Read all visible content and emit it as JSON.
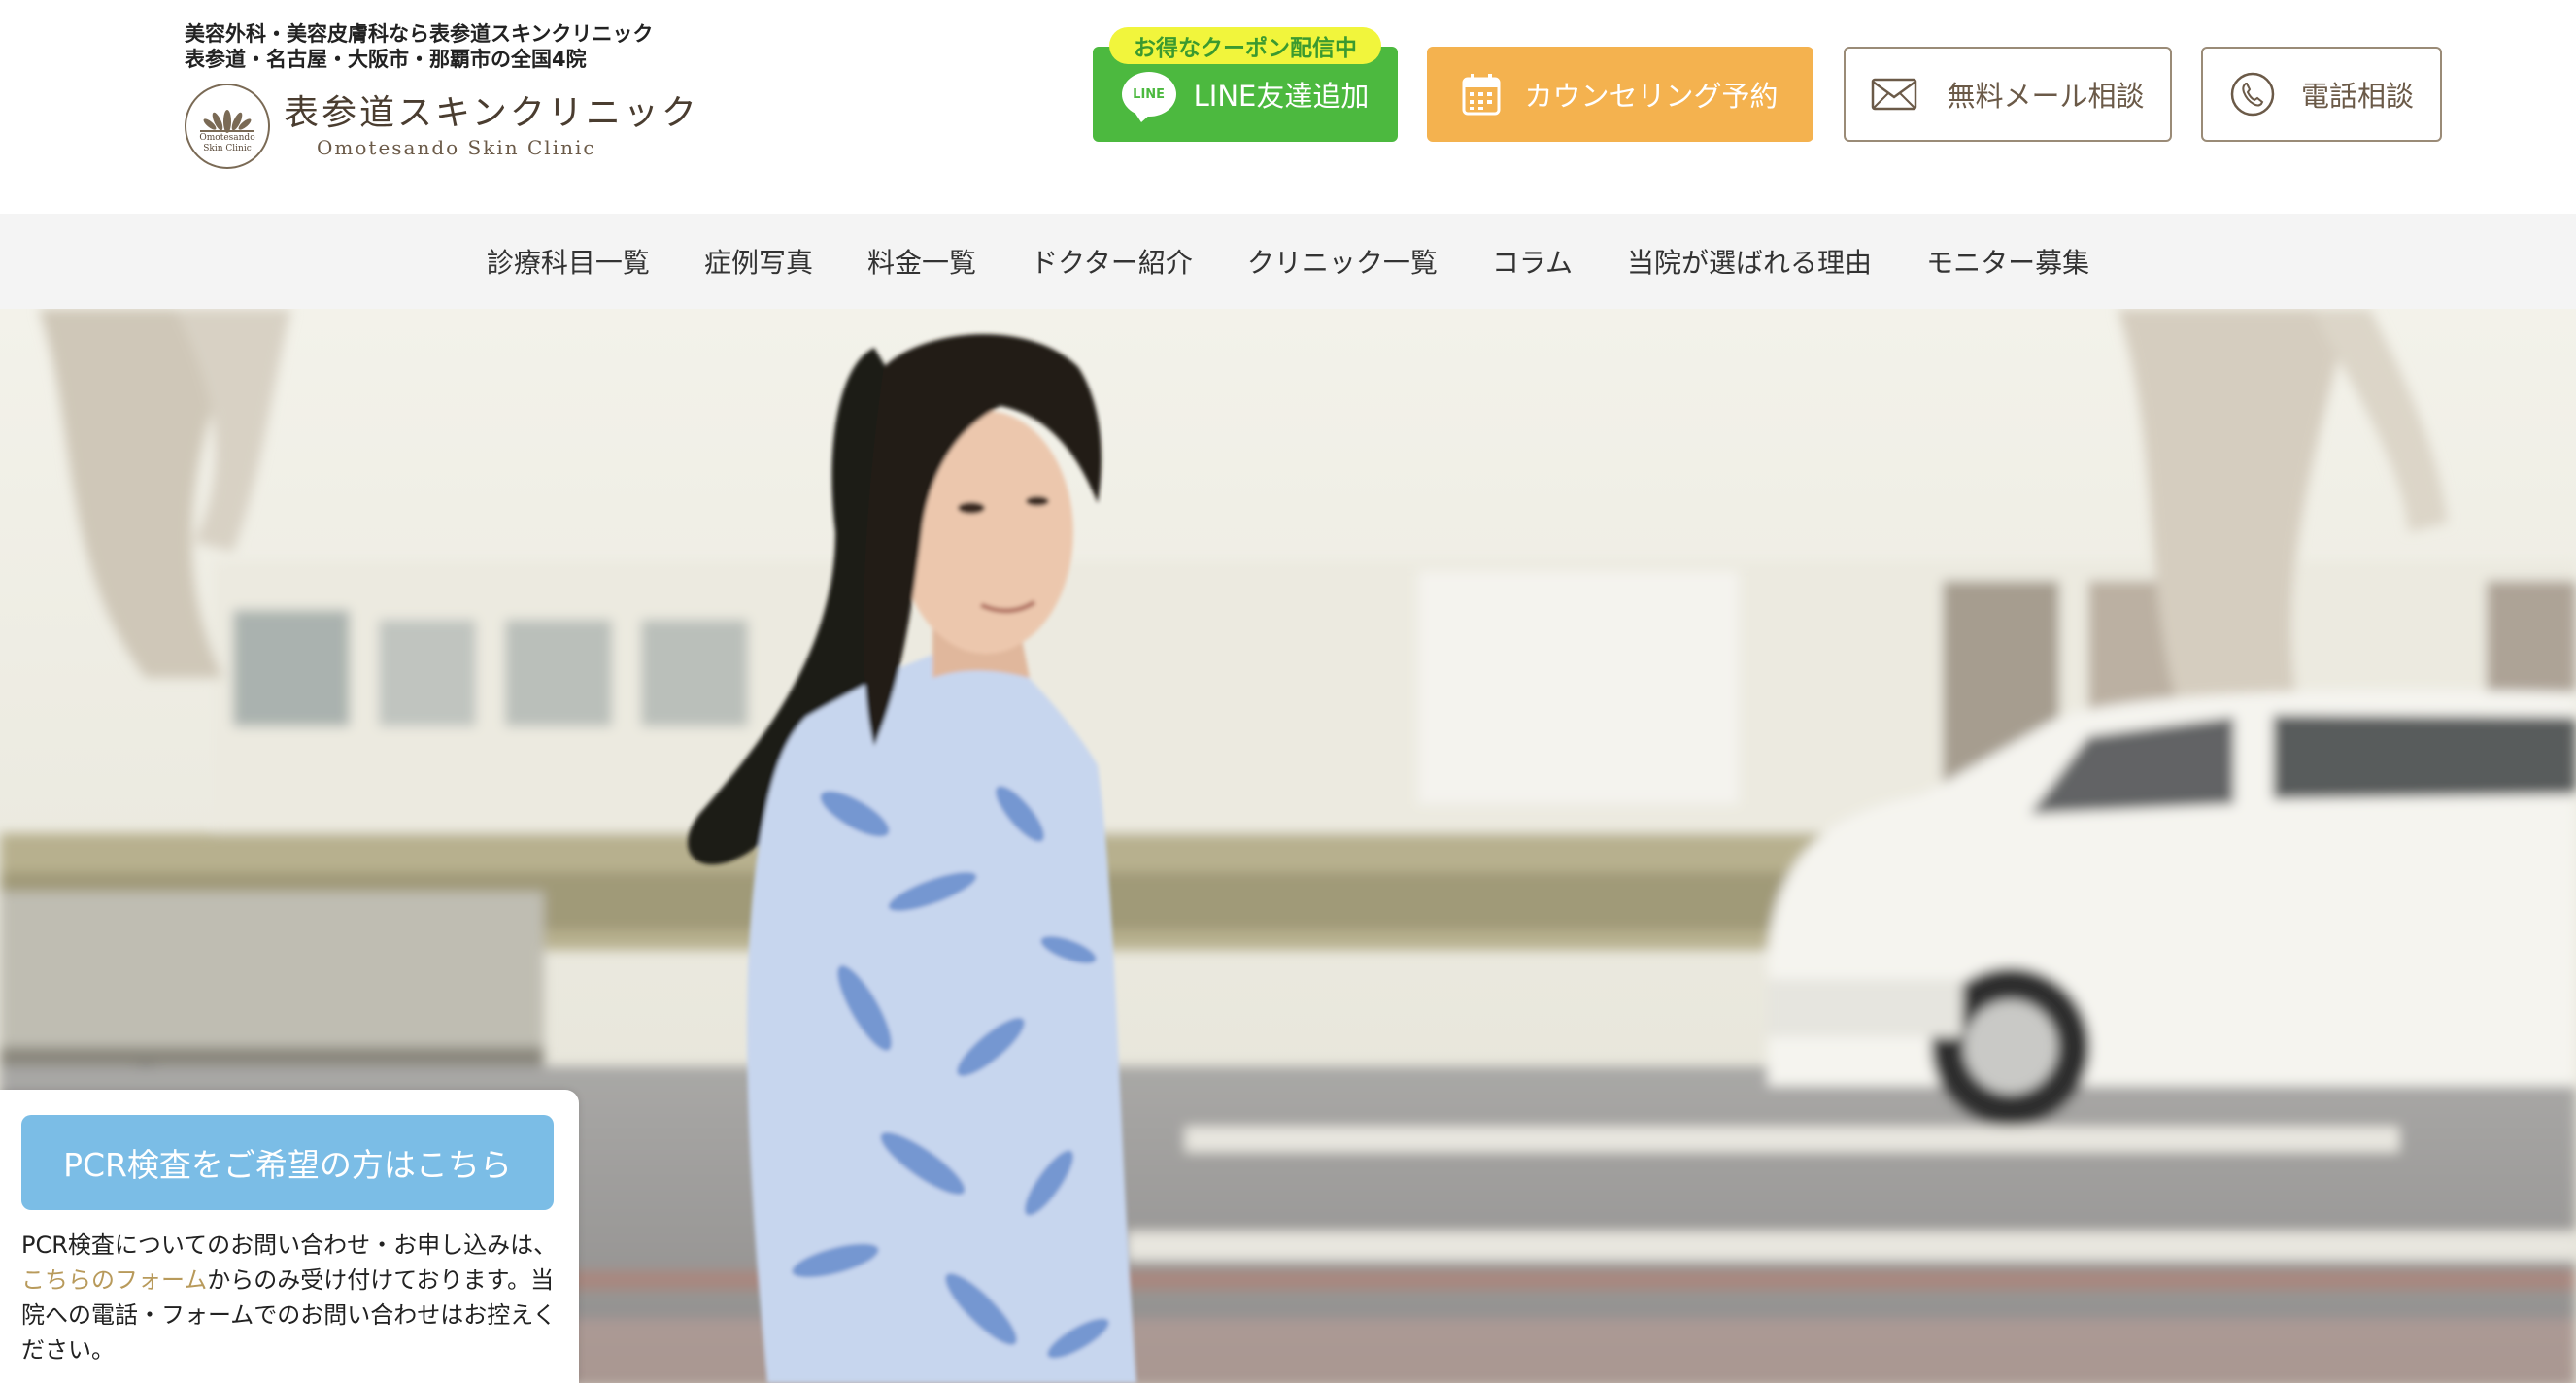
{
  "header": {
    "tagline_line1": "美容外科・美容皮膚科なら表参道スキンクリニック",
    "tagline_line2": "表参道・名古屋・大阪市・那覇市の全国4院",
    "logo_jp": "表参道スキンクリニック",
    "logo_en": "Omotesando Skin Clinic",
    "logo_mark_line1": "Omotesando",
    "logo_mark_line2": "Skin Clinic",
    "coupon_badge": "お得なクーポン配信中",
    "line_icon_text": "LINE",
    "line_button": "LINE友達追加",
    "counseling_button": "カウンセリング予約",
    "mail_button": "無料メール相談",
    "tel_button": "電話相談"
  },
  "nav": {
    "items": [
      "診療科目一覧",
      "症例写真",
      "料金一覧",
      "ドクター紹介",
      "クリニック一覧",
      "コラム",
      "当院が選ばれる理由",
      "モニター募集"
    ]
  },
  "pcr": {
    "button": "PCR検査をご希望の方はこちら",
    "text_before": "PCR検査についてのお問い合わせ・お申し込みは、",
    "link": "こちらのフォーム",
    "text_after": "からのみ受け付けております。当院への電話・フォームでのお問い合わせはお控えください。"
  },
  "colors": {
    "line_green": "#4cb93f",
    "counsel_orange": "#f4b24f",
    "coupon_yellow": "#f1f53c",
    "brand_brown": "#6b5a48",
    "pcr_blue": "#7bbde6",
    "link_gold": "#b89a5b"
  }
}
